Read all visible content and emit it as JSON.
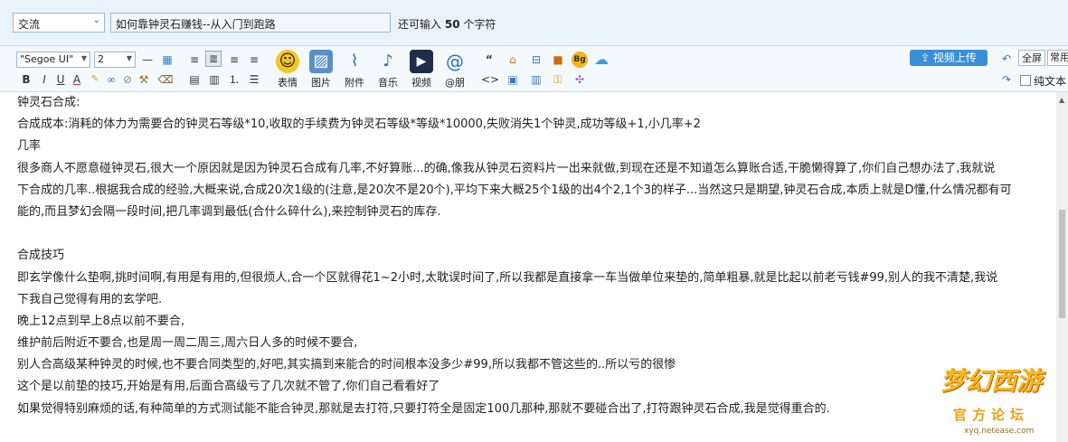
{
  "post": {
    "category": "交流",
    "title": "如何靠钟灵石赚钱--从入门到跑路",
    "remaining_prefix": "还可输入",
    "remaining_count": "50",
    "remaining_suffix": "个字符"
  },
  "toolbar": {
    "font_family": "\"Segoe UI\"",
    "font_size": "2",
    "emoji_label": "表情",
    "image_label": "图片",
    "attach_label": "附件",
    "music_label": "音乐",
    "video_label": "视频",
    "at_label": "@朋",
    "video_upload_label": "视频上传",
    "fullscreen_label": "全屏",
    "common_label": "常用",
    "plain_text_label": "纯文本"
  },
  "content": {
    "lines": [
      "钟灵石合成:",
      "合成成本:消耗的体力为需要合的钟灵石等级*10,收取的手续费为钟灵石等级*等级*10000,失败消失1个钟灵,成功等级+1,小几率+2",
      "几率",
      "很多商人不愿意碰钟灵石,很大一个原因就是因为钟灵石合成有几率,不好算账...的确,像我从钟灵石资料片一出来就做,到现在还是不知道怎么算账合适,干脆懒得算了,你们自己想办法了,我就说",
      "下合成的几率..根据我合成的经验,大概来说,合成20次1级的(注意,是20次不是20个),平均下来大概25个1级的出4个2,1个3的样子...当然这只是期望,钟灵石合成,本质上就是D懂,什么情况都有可",
      "能的,而且梦幻会隔一段时间,把几率调到最低(合什么碎什么),来控制钟灵石的库存.",
      "",
      "合成技巧",
      "即玄学像什么垫啊,挑时间啊,有用是有用的,但很烦人,合一个区就得花1~2小时,太耽误时间了,所以我都是直接拿一车当做单位来垫的,简单粗暴,就是比起以前老亏钱#99,别人的我不清楚,我说",
      "下我自己觉得有用的玄学吧.",
      "晚上12点到早上8点以前不要合,",
      "维护前后附近不要合,也是周一周二周三,周六日人多的时候不要合,",
      "别人合高级某种钟灵的时候,也不要合同类型的,好吧,其实搞到来能合的时间根本没多少#99,所以我都不管这些的..所以亏的很惨",
      "这个是以前垫的技巧,开始是有用,后面合高级亏了几次就不管了,你们自己看看好了",
      "如果觉得特别麻烦的话,有种简单的方式测试能不能合钟灵,那就是去打符,只要打符全是固定100几那种,那就不要碰合出了,打符跟钟灵石合成,我是觉得重合的."
    ]
  },
  "watermark": {
    "title": "梦幻西游",
    "subtitle": "官方论坛",
    "url": "xyq.netease.com"
  }
}
